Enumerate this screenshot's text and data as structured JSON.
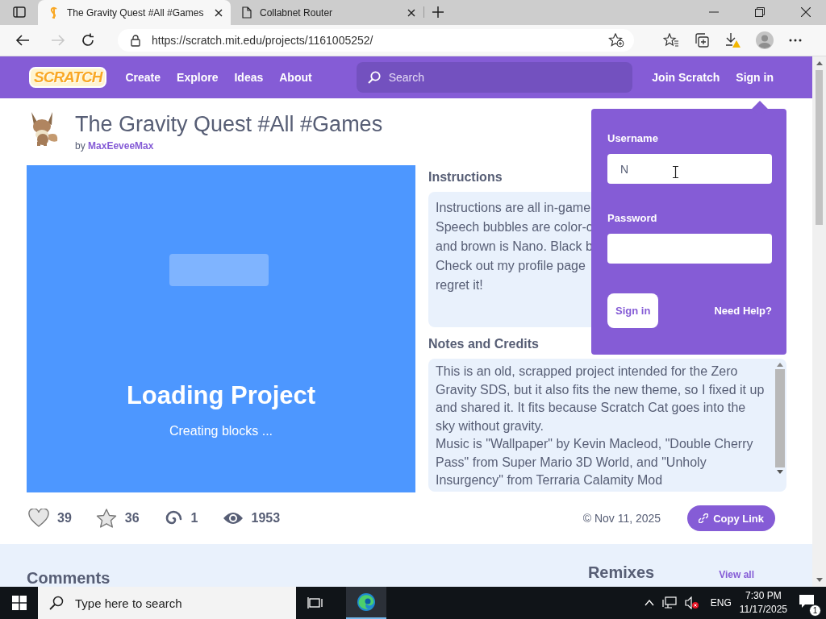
{
  "browser": {
    "tabs": [
      {
        "title": "The Gravity Quest #All #Games",
        "kind": "scratch",
        "selected": true
      },
      {
        "title": "Collabnet Router",
        "kind": "page",
        "selected": false
      }
    ],
    "url": "https://scratch.mit.edu/projects/1161005252/"
  },
  "nav": {
    "logo": "SCRATCH",
    "links": [
      "Create",
      "Explore",
      "Ideas",
      "About"
    ],
    "search": {
      "placeholder": "Search"
    },
    "join": "Join Scratch",
    "sign_in": "Sign in"
  },
  "project": {
    "title": "The Gravity Quest #All #Games",
    "by": "by",
    "author": "MaxEeveeMax",
    "player": {
      "heading": "Loading Project",
      "status": "Creating blocks ..."
    },
    "instructions": {
      "heading": "Instructions",
      "lines": [
        "Instructions are all in-game",
        "Speech bubbles are color-c",
        "and brown is Nano. Black b",
        "Check out my profile page",
        "regret it!"
      ]
    },
    "notes": {
      "heading": "Notes and Credits",
      "lines": [
        "This is an old, scrapped project intended for the Zero",
        "Gravity SDS, but it also fits the new theme, so I fixed it up",
        "and shared it. It fits because Scratch Cat goes into the",
        "sky without gravity.",
        "Music is \"Wallpaper\" by Kevin Macleod, \"Double Cherry",
        "Pass\" from Super Mario 3D World, and \"Unholy",
        "Insurgency\" from Terraria Calamity Mod"
      ]
    },
    "stats": [
      {
        "kind": "love",
        "count": "39"
      },
      {
        "kind": "favorite",
        "count": "36"
      },
      {
        "kind": "remix",
        "count": "1"
      },
      {
        "kind": "views",
        "count": "1953"
      }
    ],
    "date": "© Nov 11, 2025",
    "copy_link": "Copy Link"
  },
  "lower": {
    "comments": "Comments",
    "remixes": "Remixes",
    "view_all": "View all"
  },
  "login": {
    "username_label": "Username",
    "username": "N",
    "password_label": "Password",
    "sign_in": "Sign in",
    "help": "Need Help?"
  },
  "taskbar": {
    "search": {
      "placeholder": "Type here to search"
    },
    "language": "ENG",
    "time": "7:30 PM",
    "date": "11/17/2025",
    "notifications": "1"
  }
}
